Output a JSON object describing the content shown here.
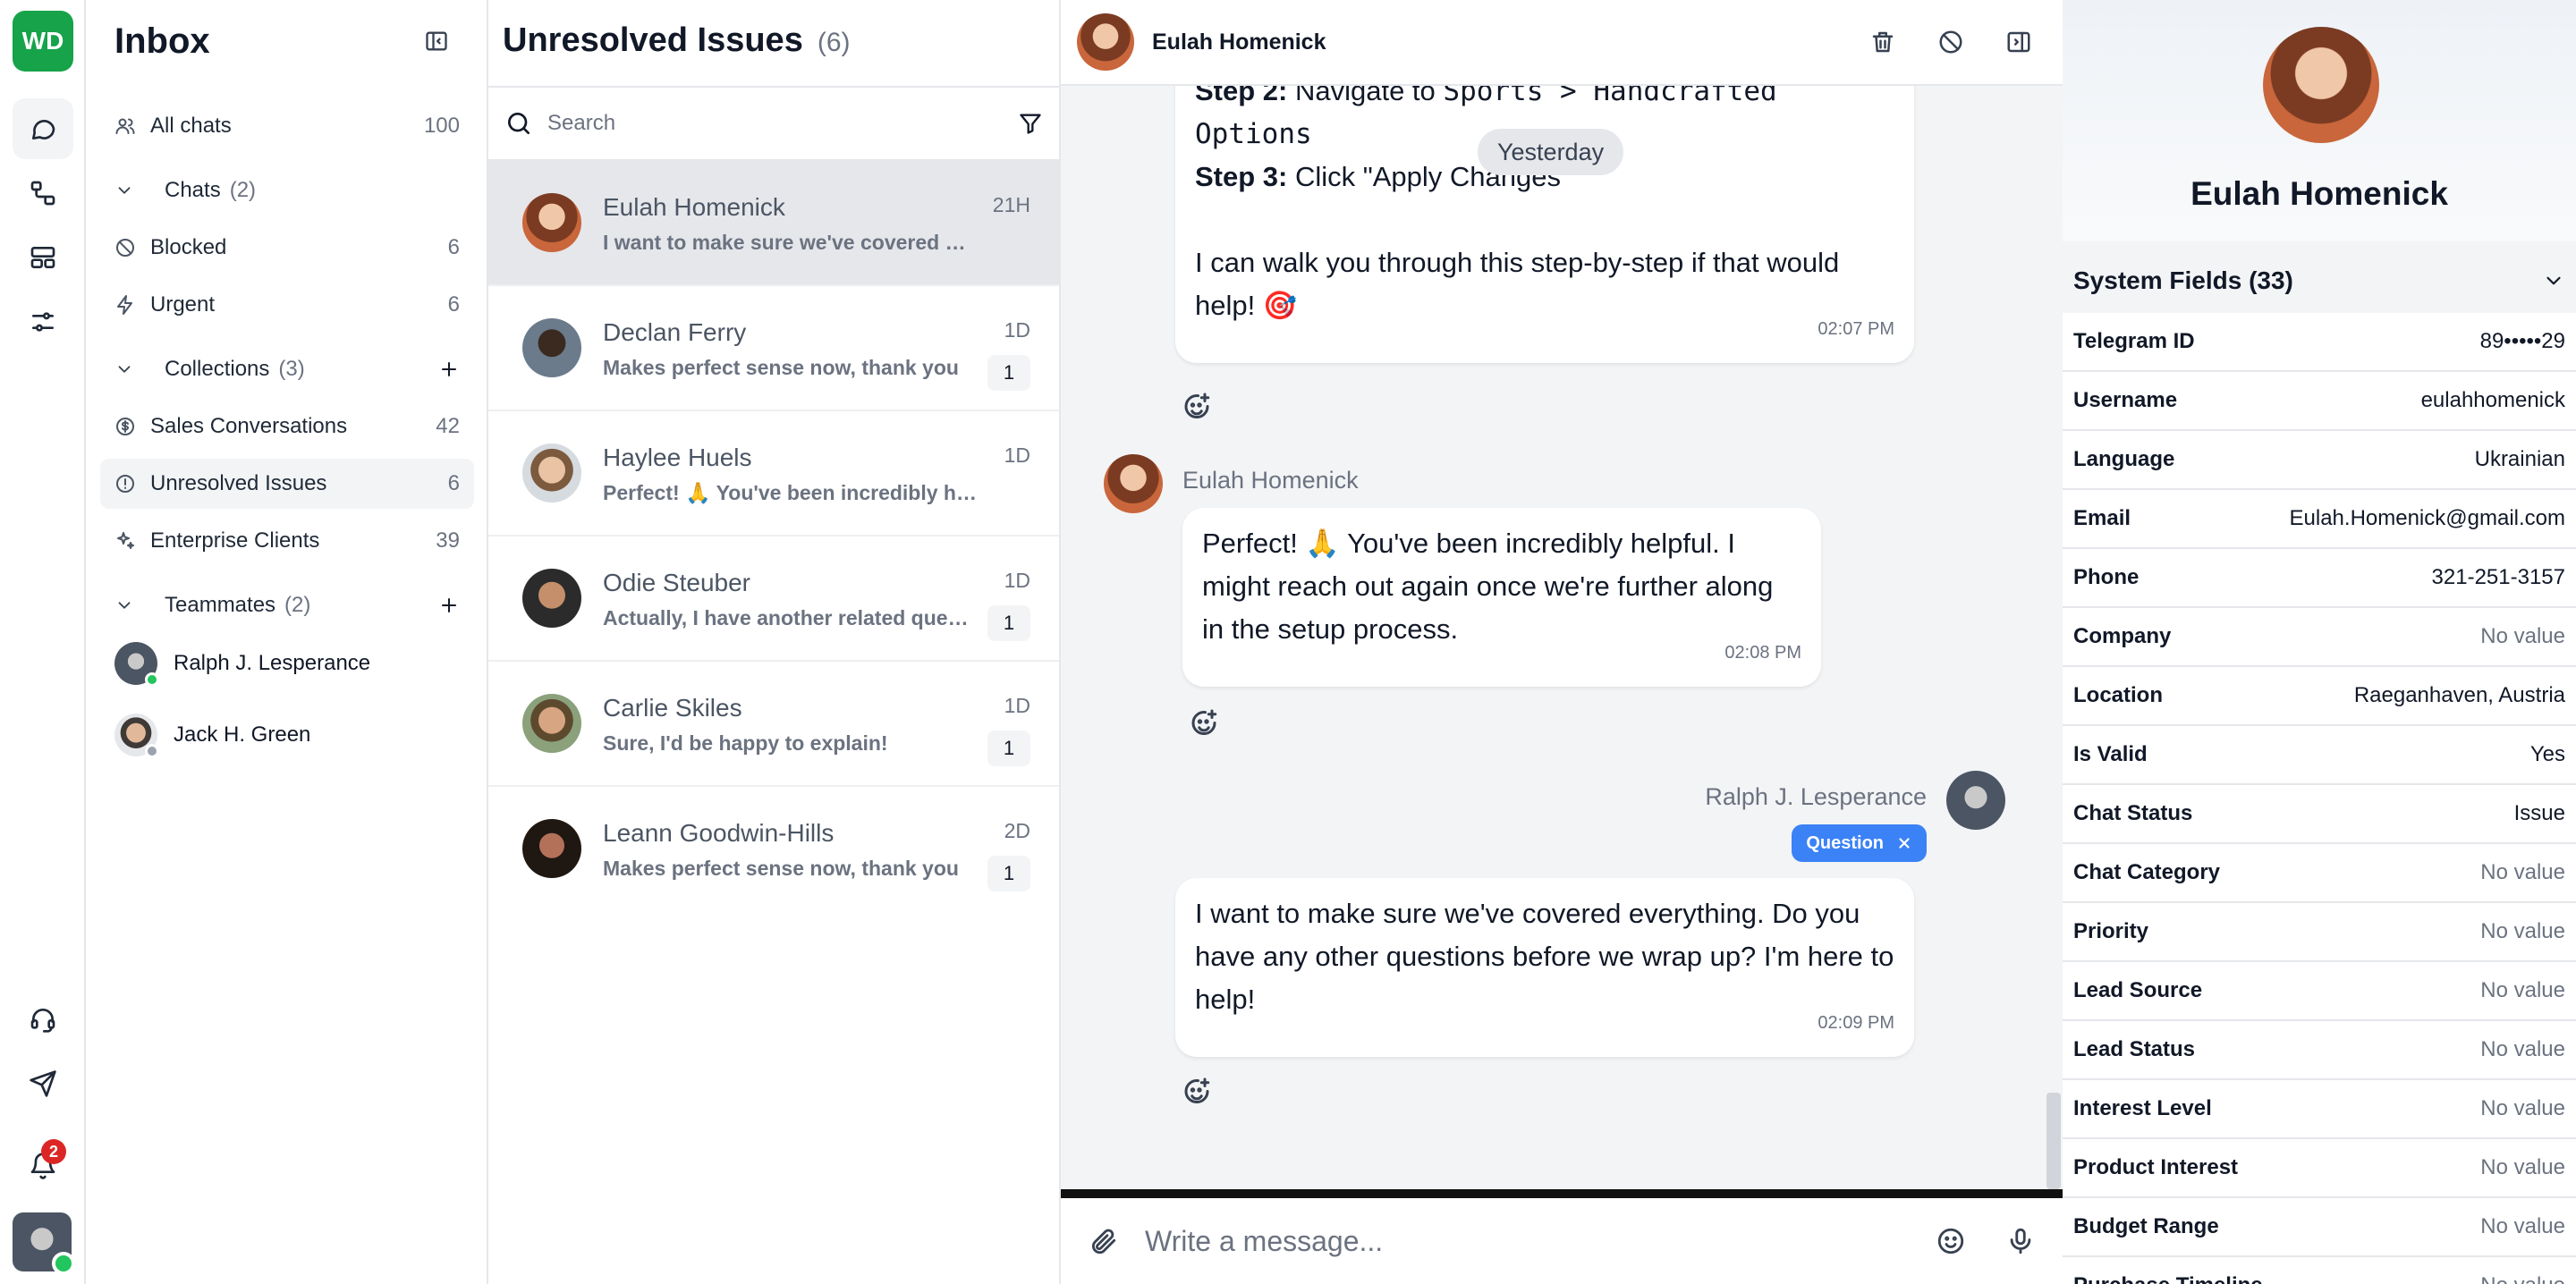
{
  "rail": {
    "logo": "WD",
    "notifications_count": "2"
  },
  "sidebar": {
    "title": "Inbox",
    "all_chats": {
      "label": "All chats",
      "count": "100"
    },
    "chats_group": {
      "label": "Chats",
      "count": "(2)"
    },
    "blocked": {
      "label": "Blocked",
      "count": "6"
    },
    "urgent": {
      "label": "Urgent",
      "count": "6"
    },
    "collections_group": {
      "label": "Collections",
      "count": "(3)"
    },
    "collections": [
      {
        "label": "Sales Conversations",
        "count": "42"
      },
      {
        "label": "Unresolved Issues",
        "count": "6"
      },
      {
        "label": "Enterprise Clients",
        "count": "39"
      }
    ],
    "teammates_group": {
      "label": "Teammates",
      "count": "(2)"
    },
    "teammates": [
      {
        "name": "Ralph J. Lesperance",
        "status_color": "#22c55e"
      },
      {
        "name": "Jack H. Green",
        "status_color": "#9ca3af"
      }
    ]
  },
  "list": {
    "title": "Unresolved Issues",
    "count": "(6)",
    "search_placeholder": "Search",
    "conversations": [
      {
        "name": "Eulah Homenick",
        "preview": "I want to make sure we've covered everything...",
        "time": "21H",
        "unread": ""
      },
      {
        "name": "Declan Ferry",
        "preview": "Makes perfect sense now, thank you",
        "time": "1D",
        "unread": "1"
      },
      {
        "name": "Haylee Huels",
        "preview": "Perfect! 🙏 You've been incredibly helpful",
        "time": "1D",
        "unread": ""
      },
      {
        "name": "Odie Steuber",
        "preview": "Actually, I have another related question",
        "time": "1D",
        "unread": "1"
      },
      {
        "name": "Carlie Skiles",
        "preview": "Sure, I'd be happy to explain!",
        "time": "1D",
        "unread": "1"
      },
      {
        "name": "Leann Goodwin-Hills",
        "preview": "Makes perfect sense now, thank you",
        "time": "2D",
        "unread": "1"
      }
    ]
  },
  "chat": {
    "contact_name": "Eulah Homenick",
    "date_separator": "Yesterday",
    "msg1": {
      "step2_label": "Step 2:",
      "step2_text": " Navigate to ",
      "step2_path": "Sports > Handcrafted Options",
      "step3_label": "Step 3:",
      "step3_text": " Click \"Apply Changes\"",
      "outro": "I can walk you through this step-by-step if that would help! 🎯",
      "time": "02:07 PM"
    },
    "msg2": {
      "sender": "Eulah Homenick",
      "text": "Perfect! 🙏 You've been incredibly helpful. I might reach out again once we're further along in the setup process.",
      "time": "02:08 PM"
    },
    "msg3": {
      "sender": "Ralph J. Lesperance",
      "tag": "Question",
      "text": "I want to make sure we've covered everything. Do you have any other questions before we wrap up? I'm here to help!",
      "time": "02:09 PM"
    },
    "composer_placeholder": "Write a message..."
  },
  "profile": {
    "name": "Eulah Homenick",
    "section_title": "System Fields (33)",
    "fields": [
      {
        "key": "Telegram ID",
        "value": "89•••••29"
      },
      {
        "key": "Username",
        "value": "eulahhomenick"
      },
      {
        "key": "Language",
        "value": "Ukrainian"
      },
      {
        "key": "Email",
        "value": "Eulah.Homenick@gmail.com"
      },
      {
        "key": "Phone",
        "value": "321-251-3157"
      },
      {
        "key": "Company",
        "value": "No value"
      },
      {
        "key": "Location",
        "value": "Raeganhaven, Austria"
      },
      {
        "key": "Is Valid",
        "value": "Yes"
      },
      {
        "key": "Chat Status",
        "value": "Issue"
      },
      {
        "key": "Chat Category",
        "value": "No value"
      },
      {
        "key": "Priority",
        "value": "No value"
      },
      {
        "key": "Lead Source",
        "value": "No value"
      },
      {
        "key": "Lead Status",
        "value": "No value"
      },
      {
        "key": "Interest Level",
        "value": "No value"
      },
      {
        "key": "Product Interest",
        "value": "No value"
      },
      {
        "key": "Budget Range",
        "value": "No value"
      },
      {
        "key": "Purchase Timeline",
        "value": "No value"
      }
    ]
  },
  "colors": {
    "brand": "#16a34a",
    "accent": "#3b82f6",
    "badge": "#dc2626"
  }
}
